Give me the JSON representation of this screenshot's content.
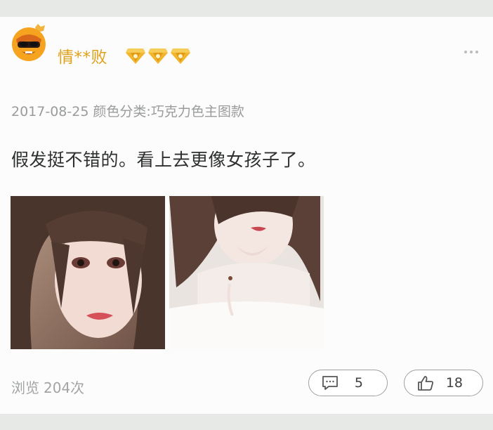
{
  "post": {
    "username": "情**败",
    "badge_icon": "diamond-icon",
    "badge_count": 3,
    "accent_color": "#e0a01a",
    "date": "2017-08-25",
    "variant": "颜色分类:巧克力色主图款",
    "review_text": "假发挺不错的。看上去更像女孩子了。",
    "photo_count": 2
  },
  "footer": {
    "views_label": "浏览",
    "views_value": "204次",
    "comments_count": "5",
    "likes_count": "18"
  }
}
